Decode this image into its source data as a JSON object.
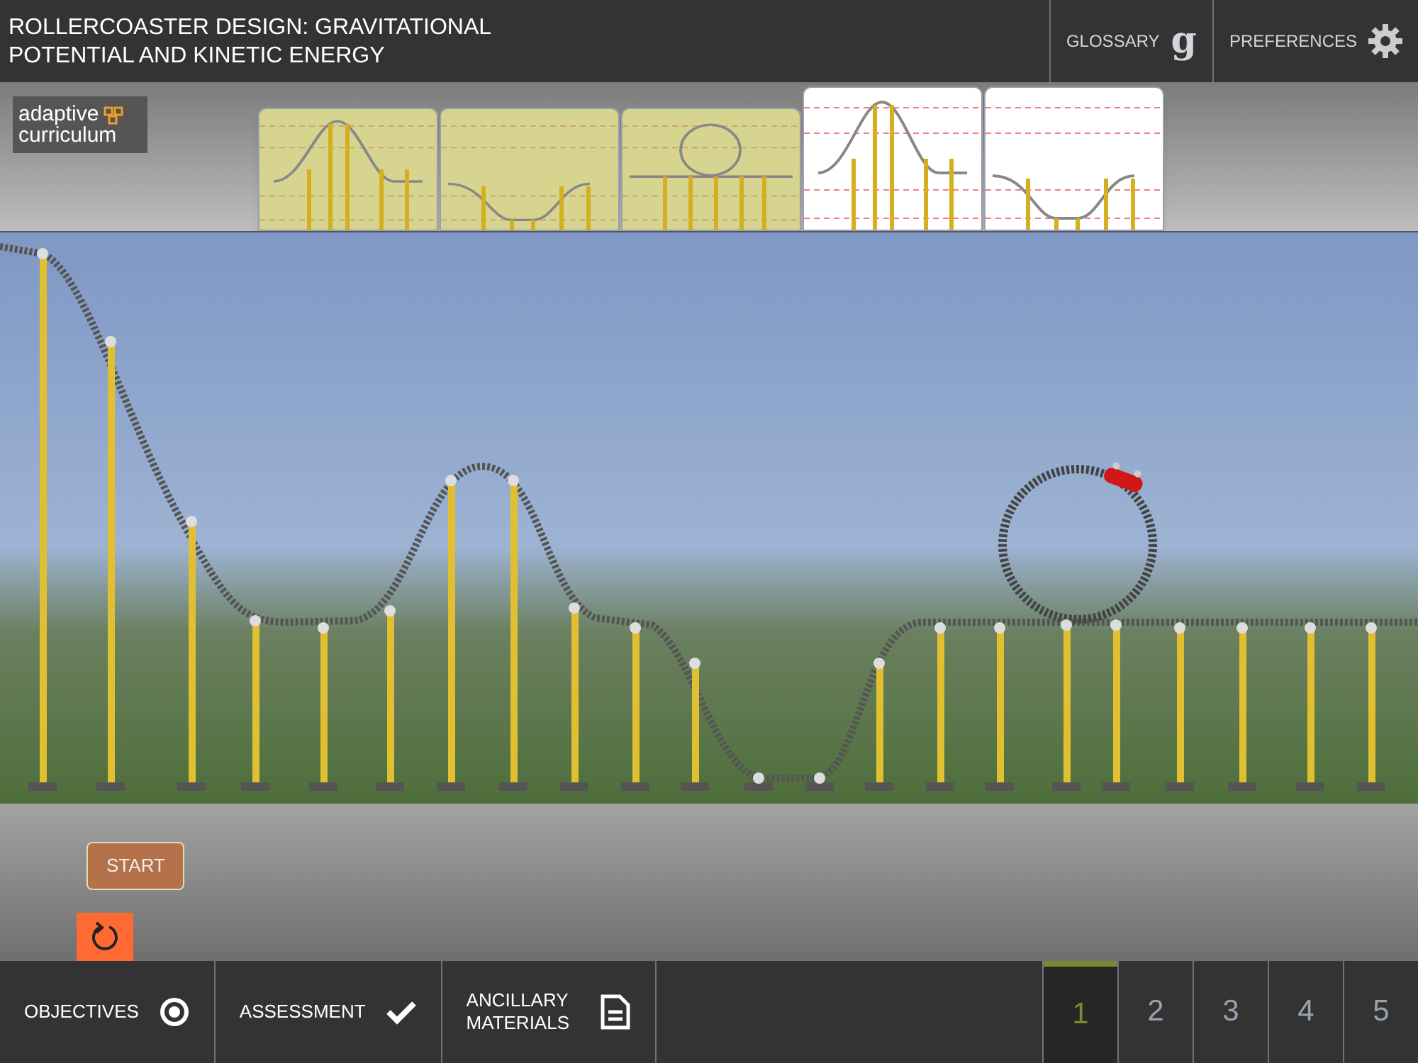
{
  "header": {
    "title": "ROLLERCOASTER DESIGN: GRAVITATIONAL POTENTIAL AND KINETIC ENERGY",
    "glossary": {
      "label": "GLOSSARY",
      "icon_letter": "g"
    },
    "preferences": {
      "label": "PREFERENCES"
    }
  },
  "logo": {
    "line1": "adaptive",
    "line2": "curriculum"
  },
  "track_pieces": [
    {
      "kind": "hill",
      "used": true
    },
    {
      "kind": "valley",
      "used": true
    },
    {
      "kind": "loop",
      "used": true
    },
    {
      "kind": "hill",
      "used": false
    },
    {
      "kind": "valley",
      "used": false
    }
  ],
  "controls": {
    "start": "START"
  },
  "nav": [
    {
      "label": "OBJECTIVES",
      "kind": "target"
    },
    {
      "label": "ASSESSMENT",
      "kind": "check"
    },
    {
      "label": "ANCILLARY MATERIALS",
      "kind": "document"
    }
  ],
  "pages": [
    {
      "label": "1",
      "selected": true
    },
    {
      "label": "2",
      "selected": false
    },
    {
      "label": "3",
      "selected": false
    },
    {
      "label": "4",
      "selected": false
    },
    {
      "label": "5",
      "selected": false
    }
  ]
}
